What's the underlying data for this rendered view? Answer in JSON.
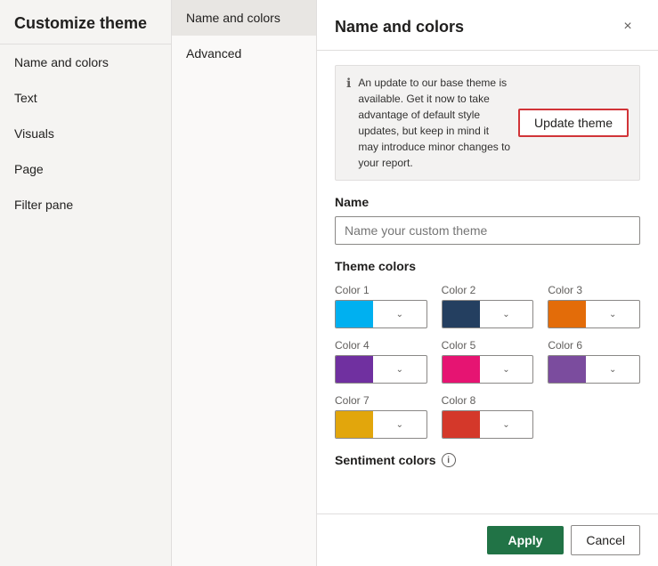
{
  "left_sidebar": {
    "title": "Customize theme",
    "nav_items": [
      {
        "id": "name-colors",
        "label": "Name and colors"
      },
      {
        "id": "text",
        "label": "Text"
      },
      {
        "id": "visuals",
        "label": "Visuals"
      },
      {
        "id": "page",
        "label": "Page"
      },
      {
        "id": "filter-pane",
        "label": "Filter pane"
      }
    ]
  },
  "middle_panel": {
    "items": [
      {
        "id": "name-and-colors",
        "label": "Name and colors",
        "active": true
      },
      {
        "id": "advanced",
        "label": "Advanced",
        "active": false
      }
    ]
  },
  "main": {
    "header_title": "Name and colors",
    "close_icon": "×",
    "info_banner": {
      "text": "An update to our base theme is available. Get it now to take advantage of default style updates, but keep in mind it may introduce minor changes to your report.",
      "icon": "ℹ"
    },
    "update_theme_btn": "Update theme",
    "name_section": {
      "label": "Name",
      "placeholder": "Name your custom theme"
    },
    "theme_colors_label": "Theme colors",
    "colors": [
      {
        "label": "Color 1",
        "color": "#00B0F0"
      },
      {
        "label": "Color 2",
        "color": "#243F60"
      },
      {
        "label": "Color 3",
        "color": "#E36C09"
      },
      {
        "label": "Color 4",
        "color": "#7030A0"
      },
      {
        "label": "Color 5",
        "color": "#E61472"
      },
      {
        "label": "Color 6",
        "color": "#7B4C9E"
      },
      {
        "label": "Color 7",
        "color": "#E2A60C"
      },
      {
        "label": "Color 8",
        "color": "#D4382A"
      }
    ],
    "sentiment_label": "Sentiment colors",
    "sentiment_info": "i",
    "footer": {
      "apply_label": "Apply",
      "cancel_label": "Cancel"
    }
  }
}
